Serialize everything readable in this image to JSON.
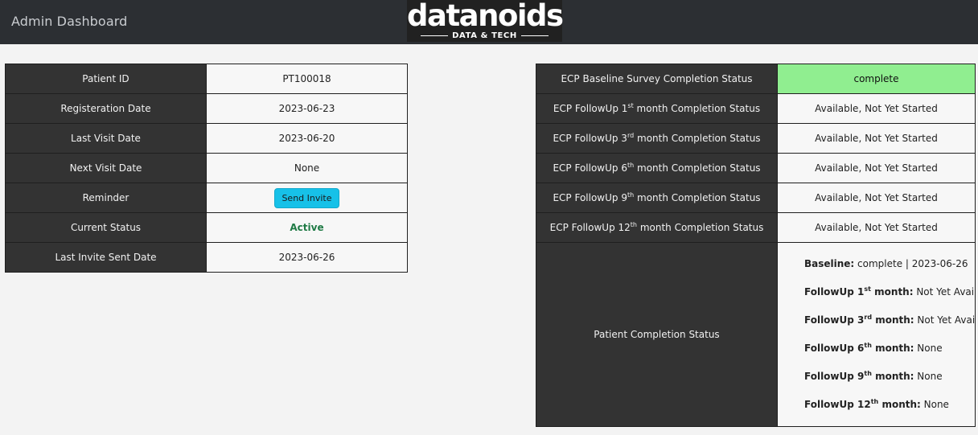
{
  "navbar": {
    "brand": "Admin Dashboard",
    "logo_main": "datanoids",
    "logo_sub": "DATA & TECH"
  },
  "patient": {
    "rows": [
      {
        "label": "Patient ID",
        "value": "PT100018"
      },
      {
        "label": "Registeration Date",
        "value": "2023-06-23"
      },
      {
        "label": "Last Visit Date",
        "value": "2023-06-20"
      },
      {
        "label": "Next Visit Date",
        "value": "None"
      },
      {
        "label": "Reminder",
        "button": "Send Invite"
      },
      {
        "label": "Current Status",
        "value": "Active"
      },
      {
        "label": "Last Invite Sent Date",
        "value": "2023-06-26"
      }
    ]
  },
  "survey": {
    "baseline": {
      "label": "ECP Baseline Survey Completion Status",
      "value": "complete"
    },
    "followups": [
      {
        "pre": "ECP FollowUp 1",
        "sup": "st",
        "post": " month Completion Status",
        "value": "Available, Not Yet Started"
      },
      {
        "pre": "ECP FollowUp 3",
        "sup": "rd",
        "post": " month Completion Status",
        "value": "Available, Not Yet Started"
      },
      {
        "pre": "ECP FollowUp 6",
        "sup": "th",
        "post": " month Completion Status",
        "value": "Available, Not Yet Started"
      },
      {
        "pre": "ECP FollowUp 9",
        "sup": "th",
        "post": " month Completion Status",
        "value": "Available, Not Yet Started"
      },
      {
        "pre": "ECP FollowUp 12",
        "sup": "th",
        "post": " month Completion Status",
        "value": "Available, Not Yet Started"
      }
    ],
    "patient_completion": {
      "label": "Patient Completion Status",
      "baseline_label": "Baseline:",
      "baseline_value": " complete | 2023-06-26",
      "items": [
        {
          "pre": "FollowUp 1",
          "sup": "st",
          "post": " month:",
          "value": " Not Yet Available"
        },
        {
          "pre": "FollowUp 3",
          "sup": "rd",
          "post": " month:",
          "value": " Not Yet Available"
        },
        {
          "pre": "FollowUp 6",
          "sup": "th",
          "post": " month:",
          "value": " None"
        },
        {
          "pre": "FollowUp 9",
          "sup": "th",
          "post": " month:",
          "value": " None"
        },
        {
          "pre": "FollowUp 12",
          "sup": "th",
          "post": " month:",
          "value": " None"
        }
      ]
    }
  },
  "colors": {
    "navbar_bg": "#2c2f33",
    "label_bg": "#333333",
    "complete_bg": "#90ee90",
    "button_bg": "#17c1e8",
    "active_text": "#1f7a45"
  }
}
